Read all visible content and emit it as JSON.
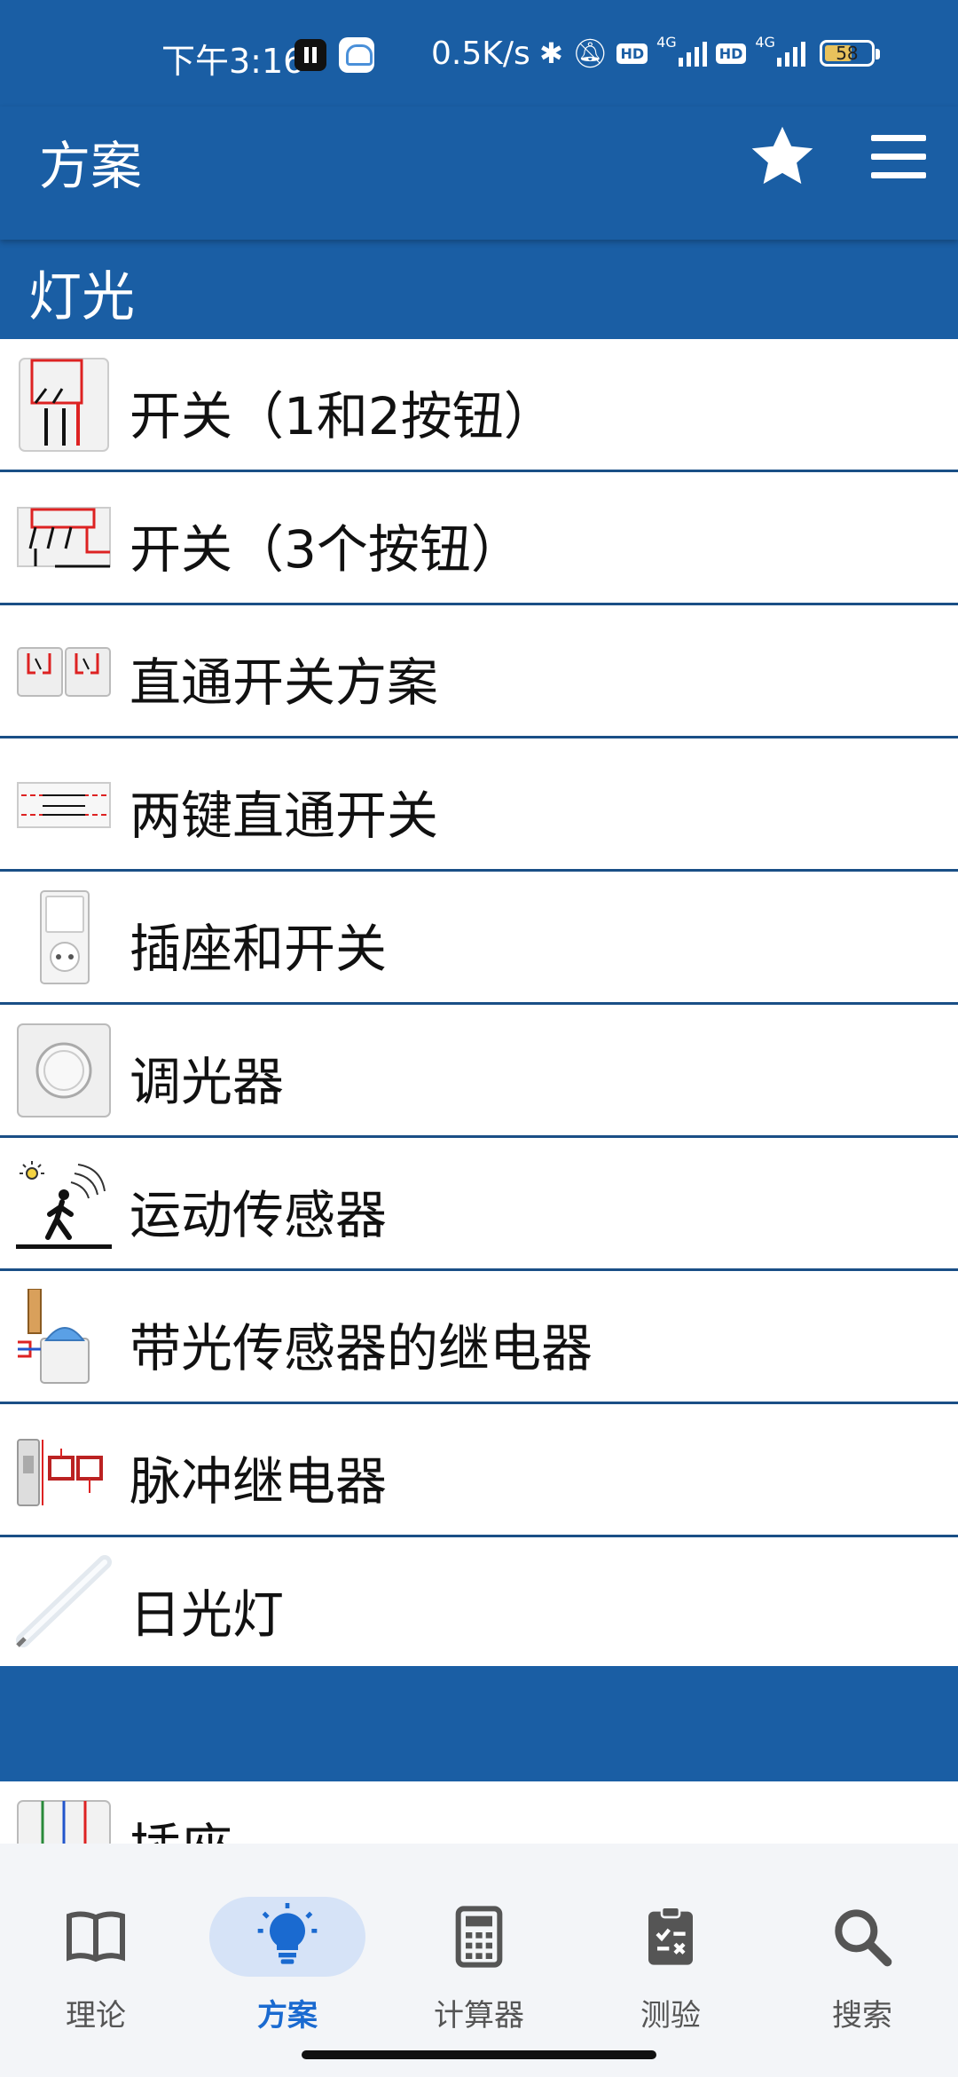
{
  "status_bar": {
    "time": "下午3:16",
    "net_speed": "0.5K/s",
    "hd_1": "HD",
    "net_1": "4G",
    "hd_2": "HD",
    "net_2": "4G",
    "battery": "58"
  },
  "app_bar": {
    "title": "方案",
    "favorite_icon": "star-icon",
    "menu_icon": "hamburger-icon"
  },
  "sections": [
    {
      "title": "灯光",
      "items": [
        {
          "label": "开关（1和2按钮）",
          "icon": "switch-1-2-buttons-diagram"
        },
        {
          "label": "开关（3个按钮）",
          "icon": "switch-3-buttons-diagram"
        },
        {
          "label": "直通开关方案",
          "icon": "pass-through-switch-diagram"
        },
        {
          "label": "两键直通开关",
          "icon": "two-key-pass-through-diagram"
        },
        {
          "label": "插座和开关",
          "icon": "socket-and-switch"
        },
        {
          "label": "调光器",
          "icon": "dimmer"
        },
        {
          "label": "运动传感器",
          "icon": "motion-sensor"
        },
        {
          "label": "带光传感器的继电器",
          "icon": "photo-relay"
        },
        {
          "label": "脉冲继电器",
          "icon": "impulse-relay"
        },
        {
          "label": "日光灯",
          "icon": "fluorescent-tube"
        }
      ]
    },
    {
      "title": "",
      "items": [
        {
          "label": "插座",
          "icon": "socket-diagram"
        }
      ]
    }
  ],
  "bottom_nav": [
    {
      "label": "理论",
      "icon": "book-icon",
      "active": false
    },
    {
      "label": "方案",
      "icon": "lightbulb-icon",
      "active": true
    },
    {
      "label": "计算器",
      "icon": "calculator-icon",
      "active": false
    },
    {
      "label": "测验",
      "icon": "clipboard-icon",
      "active": false
    },
    {
      "label": "搜索",
      "icon": "search-icon",
      "active": false
    }
  ],
  "colors": {
    "primary": "#1a5ea4",
    "nav_active": "#1a6ad0",
    "nav_pill": "#d6e3f7",
    "divider": "#1a4f86"
  }
}
